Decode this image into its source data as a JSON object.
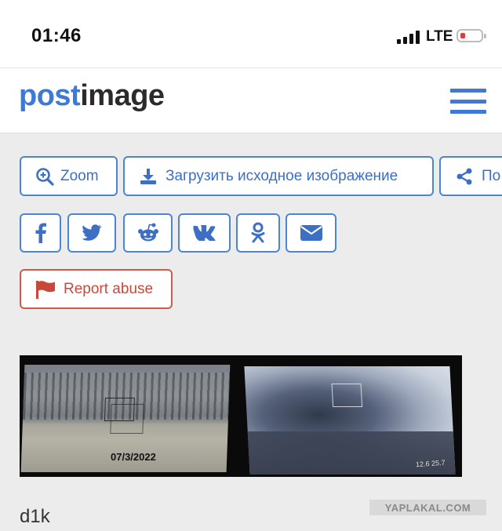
{
  "status_bar": {
    "time": "01:46",
    "network": "LTE",
    "battery_color": "#e53935"
  },
  "header": {
    "logo_part1": "post",
    "logo_part2": "image",
    "menu_icon": "hamburger-menu-icon",
    "brand_color": "#3d7ad6"
  },
  "actions": {
    "zoom_label": "Zoom",
    "download_label": "Загрузить исходное изображение",
    "share_label": "По"
  },
  "social_buttons": [
    "facebook-icon",
    "twitter-icon",
    "reddit-icon",
    "vk-icon",
    "odnoklassniki-icon",
    "email-icon"
  ],
  "report": {
    "label": "Report abuse",
    "color": "#c9483a"
  },
  "image": {
    "overlay_date": "07/3/2022",
    "overlay_scale": "12.6 25.7"
  },
  "caption": "d1k",
  "watermark": "YAPLAKAL.COM"
}
